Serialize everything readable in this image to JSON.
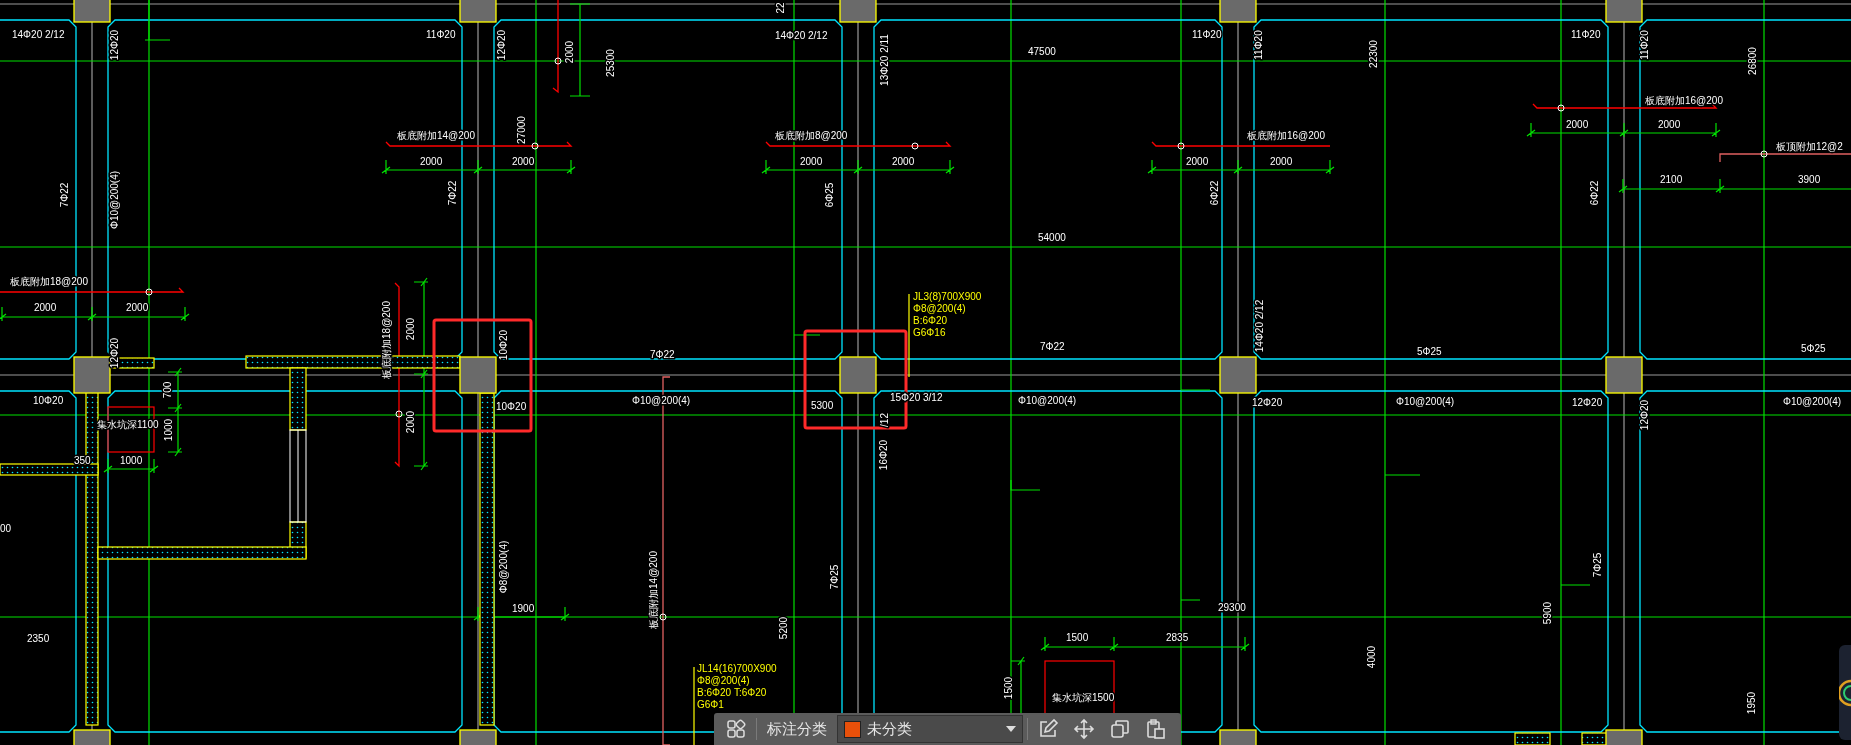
{
  "drawing": {
    "labels": [
      {
        "text": "14Φ20 2/12",
        "kind": "annotation"
      },
      {
        "text": "12Φ20",
        "kind": "annotation"
      },
      {
        "text": "11Φ20",
        "kind": "annotation"
      },
      {
        "text": "12Φ20",
        "kind": "annotation"
      },
      {
        "text": "2000",
        "kind": "annotation"
      },
      {
        "text": "25300",
        "kind": "annotation"
      },
      {
        "text": "22",
        "kind": "annotation"
      },
      {
        "text": "14Φ20 2/12",
        "kind": "annotation"
      },
      {
        "text": "13Φ20 2/11",
        "kind": "annotation"
      },
      {
        "text": "47500",
        "kind": "annotation"
      },
      {
        "text": "11Φ20",
        "kind": "annotation"
      },
      {
        "text": "11Φ20",
        "kind": "annotation"
      },
      {
        "text": "22300",
        "kind": "annotation"
      },
      {
        "text": "11Φ20",
        "kind": "annotation"
      },
      {
        "text": "11Φ20",
        "kind": "annotation"
      },
      {
        "text": "26800",
        "kind": "annotation"
      },
      {
        "text": "板底附加14@200",
        "kind": "annotation"
      },
      {
        "text": "27000",
        "kind": "annotation"
      },
      {
        "text": "2000",
        "kind": "annotation"
      },
      {
        "text": "2000",
        "kind": "annotation"
      },
      {
        "text": "板底附加8@200",
        "kind": "annotation"
      },
      {
        "text": "2000",
        "kind": "annotation"
      },
      {
        "text": "2000",
        "kind": "annotation"
      },
      {
        "text": "板底附加16@200",
        "kind": "annotation"
      },
      {
        "text": "2000",
        "kind": "annotation"
      },
      {
        "text": "2000",
        "kind": "annotation"
      },
      {
        "text": "板顶附加12@2",
        "kind": "annotation"
      },
      {
        "text": "2000",
        "kind": "annotation"
      },
      {
        "text": "板底附加16@200",
        "kind": "annotation"
      },
      {
        "text": "2000",
        "kind": "annotation"
      },
      {
        "text": "2100",
        "kind": "annotation"
      },
      {
        "text": "3900",
        "kind": "annotation"
      },
      {
        "text": "7Φ22",
        "kind": "annotation"
      },
      {
        "text": "Φ10@200(4)",
        "kind": "annotation"
      },
      {
        "text": "7Φ22",
        "kind": "annotation"
      },
      {
        "text": "6Φ25",
        "kind": "annotation"
      },
      {
        "text": "6Φ22",
        "kind": "annotation"
      },
      {
        "text": "6Φ22",
        "kind": "annotation"
      },
      {
        "text": "54000",
        "kind": "annotation"
      },
      {
        "text": "板底附加18@200",
        "kind": "annotation"
      },
      {
        "text": "2000",
        "kind": "annotation"
      },
      {
        "text": "2000",
        "kind": "annotation"
      },
      {
        "text": "板底附加18@200",
        "kind": "annotation"
      },
      {
        "text": "2000",
        "kind": "annotation"
      },
      {
        "text": "2000",
        "kind": "annotation"
      },
      {
        "text": "12Φ20",
        "kind": "annotation"
      },
      {
        "text": "10Φ20",
        "kind": "annotation"
      },
      {
        "text": "10Φ20",
        "kind": "annotation"
      },
      {
        "text": "10Φ20",
        "kind": "annotation"
      },
      {
        "text": "集水坑深1100",
        "kind": "annotation"
      },
      {
        "text": "700",
        "kind": "annotation"
      },
      {
        "text": "1000",
        "kind": "annotation"
      },
      {
        "text": "350",
        "kind": "annotation"
      },
      {
        "text": "1000",
        "kind": "annotation"
      },
      {
        "text": "00",
        "kind": "annotation"
      },
      {
        "text": "2350",
        "kind": "annotation"
      },
      {
        "text": "Φ8@200(4)",
        "kind": "annotation"
      },
      {
        "text": "1900",
        "kind": "annotation"
      },
      {
        "text": "7Φ22",
        "kind": "annotation"
      },
      {
        "text": "Φ10@200(4)",
        "kind": "annotation"
      },
      {
        "text": "5300",
        "kind": "annotation"
      },
      {
        "text": "15Φ20 3/12",
        "kind": "annotation"
      },
      {
        "text": "/12",
        "kind": "annotation"
      },
      {
        "text": "16Φ20",
        "kind": "annotation"
      },
      {
        "text": "7Φ22",
        "kind": "annotation"
      },
      {
        "text": "Φ10@200(4)",
        "kind": "annotation"
      },
      {
        "text": "5Φ25",
        "kind": "annotation"
      },
      {
        "text": "5Φ25",
        "kind": "annotation"
      },
      {
        "text": "14Φ20 2/12",
        "kind": "annotation"
      },
      {
        "text": "12Φ20",
        "kind": "annotation"
      },
      {
        "text": "Φ10@200(4)",
        "kind": "annotation"
      },
      {
        "text": "12Φ20",
        "kind": "annotation"
      },
      {
        "text": "12Φ20",
        "kind": "annotation"
      },
      {
        "text": "Φ10@200(4)",
        "kind": "annotation"
      },
      {
        "text": "板底附加14@200",
        "kind": "annotation"
      },
      {
        "text": "7Φ25",
        "kind": "annotation"
      },
      {
        "text": "7Φ25",
        "kind": "annotation"
      },
      {
        "text": "5200",
        "kind": "annotation"
      },
      {
        "text": "29300",
        "kind": "annotation"
      },
      {
        "text": "5900",
        "kind": "annotation"
      },
      {
        "text": "4000",
        "kind": "annotation"
      },
      {
        "text": "1950",
        "kind": "annotation"
      },
      {
        "text": "1500",
        "kind": "annotation"
      },
      {
        "text": "2835",
        "kind": "annotation"
      },
      {
        "text": "1500",
        "kind": "annotation"
      },
      {
        "text": "集水坑深1500",
        "kind": "annotation"
      },
      {
        "text": "JL3(8)700X900",
        "kind": "beam-note"
      },
      {
        "text": "Φ8@200(4)",
        "kind": "beam-note"
      },
      {
        "text": "B:6Φ20",
        "kind": "beam-note"
      },
      {
        "text": "G6Φ16",
        "kind": "beam-note"
      },
      {
        "text": "JL14(16)700X900",
        "kind": "beam-note"
      },
      {
        "text": "Φ8@200(4)",
        "kind": "beam-note"
      },
      {
        "text": "B:6Φ20  T:6Φ20",
        "kind": "beam-note"
      },
      {
        "text": "G6Φ1",
        "kind": "beam-note"
      }
    ]
  },
  "toolbar": {
    "category_label": "标注分类",
    "category_value": "未分类"
  }
}
